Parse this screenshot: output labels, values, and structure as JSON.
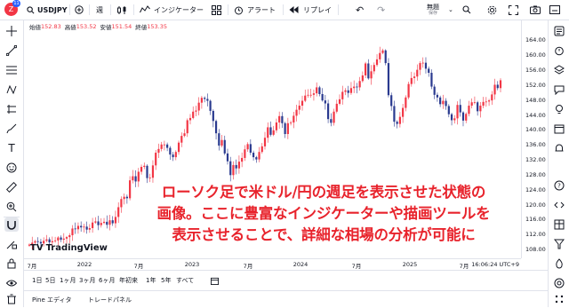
{
  "toolbar": {
    "avatar_letter": "Z",
    "avatar_badge": "11",
    "symbol": "USDJPY",
    "interval": "週",
    "indicators_label": "インジケーター",
    "alert_label": "アラート",
    "replay_label": "リプレイ",
    "layout_name": "無題",
    "layout_status": "保存"
  },
  "legend": {
    "open_label": "始値",
    "open_value": "152.83",
    "high_label": "高値",
    "high_value": "153.52",
    "low_label": "安値",
    "low_value": "151.54",
    "close_label": "終値",
    "close_value": "153.35"
  },
  "price_axis": [
    "164.00",
    "160.00",
    "156.00",
    "152.00",
    "148.00",
    "144.00",
    "140.00",
    "136.00",
    "132.00",
    "128.00",
    "124.00",
    "120.00",
    "116.00",
    "112.00",
    "108.00"
  ],
  "time_axis": [
    "7月",
    "2022",
    "7月",
    "2023",
    "7月",
    "2024",
    "7月",
    "2025",
    "7月"
  ],
  "time_axis_end": "16:06:24 UTC+9",
  "caption": {
    "line1": "ローソク足で米ドル/円の週足を表示させた状態の",
    "line2": "画像。ここに豊富なインジケーターや描画ツールを",
    "line3": "表示させることで、詳細な相場の分析が可能に"
  },
  "watermark": "TradingView",
  "ranges": [
    "1日",
    "5日",
    "1ヶ月",
    "3ヶ月",
    "6ヶ月",
    "年初来",
    "1年",
    "5年",
    "すべて"
  ],
  "panels": [
    "Pine エディタ",
    "トレードパネル"
  ],
  "colors": {
    "up": "#f23645",
    "down": "#2a3a8f",
    "accent": "#2962ff",
    "caption": "#e8232c"
  },
  "chart_data": {
    "type": "candlestick",
    "symbol": "USDJPY",
    "interval": "weekly",
    "ylim": [
      108,
      166
    ],
    "x_range": [
      "2021-05",
      "2025-10"
    ],
    "weekly_closes_estimate": [
      109.3,
      109.8,
      110.2,
      110.0,
      109.6,
      110.3,
      110.7,
      109.9,
      110.2,
      110.4,
      111.2,
      110.6,
      110.9,
      111.3,
      111.8,
      113.6,
      113.4,
      114.3,
      113.9,
      114.1,
      113.3,
      113.7,
      115.2,
      115.5,
      114.5,
      115.1,
      115.4,
      114.6,
      115.8,
      115.0,
      116.7,
      119.3,
      121.5,
      122.1,
      121.7,
      126.5,
      127.6,
      126.2,
      128.8,
      130.1,
      130.4,
      127.1,
      127.2,
      130.5,
      133.9,
      134.9,
      136.1,
      136.1,
      135.2,
      133.4,
      132.7,
      134.1,
      136.6,
      138.4,
      139.1,
      142.6,
      143.2,
      144.9,
      145.2,
      147.3,
      148.6,
      148.3,
      147.8,
      145.1,
      142.4,
      139.1,
      135.8,
      137.3,
      133.7,
      131.6,
      127.9,
      130.6,
      129.7,
      131.5,
      132.5,
      134.8,
      136.2,
      133.9,
      132.7,
      132.1,
      134.1,
      135.6,
      137.9,
      140.7,
      138.7,
      139.9,
      142.0,
      143.7,
      141.8,
      138.9,
      141.8,
      142.0,
      143.8,
      145.4,
      146.5,
      147.8,
      149.2,
      149.4,
      149.4,
      149.8,
      151.4,
      149.6,
      147.9,
      147.1,
      142.9,
      141.9,
      144.9,
      147.0,
      148.2,
      150.2,
      150.6,
      149.9,
      151.2,
      151.6,
      151.4,
      153.1,
      154.6,
      157.8,
      153.8,
      155.7,
      157.4,
      158.9,
      160.6,
      161.3,
      157.9,
      149.3,
      146.4,
      142.2,
      141.6,
      143.5,
      145.9,
      148.7,
      152.3,
      153.9,
      154.3,
      156.1,
      157.9,
      158.0,
      156.4,
      155.3,
      151.6,
      149.4,
      148.7,
      146.9,
      147.8,
      146.4,
      144.2,
      142.6,
      143.1,
      146.7,
      144.7,
      142.5,
      144.3,
      146.5,
      147.4,
      147.4,
      145.0,
      146.5,
      147.5,
      147.6,
      147.9,
      149.5,
      152.1,
      151.2,
      153.3
    ]
  }
}
